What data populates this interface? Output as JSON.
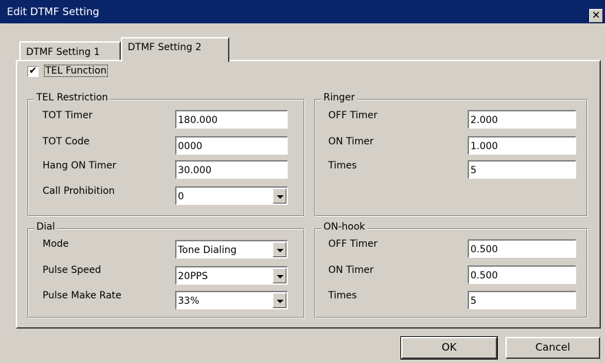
{
  "window": {
    "title": "Edit DTMF Setting",
    "close_label": "✕"
  },
  "tabs": [
    {
      "label": "DTMF Setting 1"
    },
    {
      "label": "DTMF Setting 2"
    }
  ],
  "tel_function": {
    "label": "TEL Function",
    "checked": true,
    "check_glyph": "✔"
  },
  "tel_restriction": {
    "title": "TEL Restriction",
    "tot_timer": {
      "label": "TOT Timer",
      "value": "180.000"
    },
    "tot_code": {
      "label": "TOT Code",
      "value": "0000"
    },
    "hang_on_timer": {
      "label": "Hang ON Timer",
      "value": "30.000"
    },
    "call_prohibition": {
      "label": "Call Prohibition",
      "value": "0"
    }
  },
  "ringer": {
    "title": "Ringer",
    "off_timer": {
      "label": "OFF Timer",
      "value": "2.000"
    },
    "on_timer": {
      "label": "ON Timer",
      "value": "1.000"
    },
    "times": {
      "label": "Times",
      "value": "5"
    }
  },
  "dial": {
    "title": "Dial",
    "mode": {
      "label": "Mode",
      "value": "Tone Dialing"
    },
    "pulse_speed": {
      "label": "Pulse Speed",
      "value": "20PPS"
    },
    "pulse_make_rate": {
      "label": "Pulse Make Rate",
      "value": "33%"
    }
  },
  "on_hook": {
    "title": "ON-hook",
    "off_timer": {
      "label": "OFF Timer",
      "value": "0.500"
    },
    "on_timer": {
      "label": "ON Timer",
      "value": "0.500"
    },
    "times": {
      "label": "Times",
      "value": "5"
    }
  },
  "buttons": {
    "ok": "OK",
    "cancel": "Cancel"
  },
  "colors": {
    "titlebar": "#0a246a",
    "face": "#d4d0c8"
  }
}
